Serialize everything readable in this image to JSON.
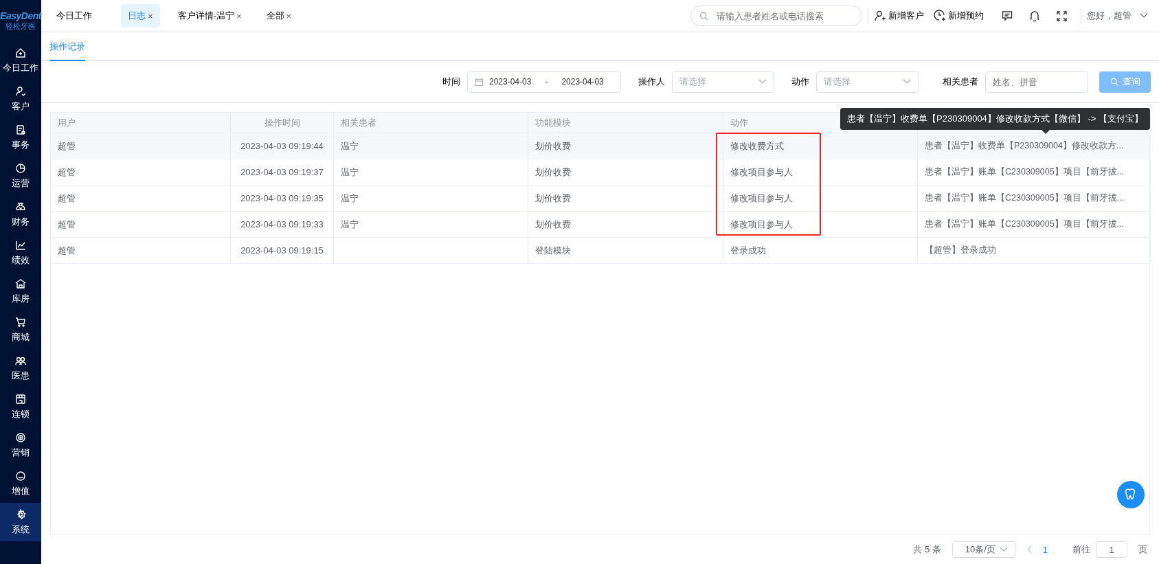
{
  "logo": {
    "brand": "EasyDent",
    "subtitle": "轻松牙医"
  },
  "sidebar": {
    "items": [
      {
        "label": "今日工作",
        "selected": false
      },
      {
        "label": "客户",
        "selected": false
      },
      {
        "label": "事务",
        "selected": false
      },
      {
        "label": "运营",
        "selected": false
      },
      {
        "label": "财务",
        "selected": false
      },
      {
        "label": "绩效",
        "selected": false
      },
      {
        "label": "库房",
        "selected": false
      },
      {
        "label": "商城",
        "selected": false
      },
      {
        "label": "医患",
        "selected": false
      },
      {
        "label": "连锁",
        "selected": false
      },
      {
        "label": "营销",
        "selected": false
      },
      {
        "label": "增值",
        "selected": false
      },
      {
        "label": "系统",
        "selected": true
      }
    ]
  },
  "tabs": [
    {
      "label": "今日工作",
      "selected": false
    },
    {
      "label": "日志",
      "selected": true,
      "close": "×"
    },
    {
      "label": "客户详情-温宁",
      "selected": false,
      "close": "×"
    },
    {
      "label": "全部",
      "selected": false,
      "close": "×"
    }
  ],
  "search": {
    "placeholder": "请输入患者姓名或电话搜索"
  },
  "header_actions": [
    {
      "label": "新增客户"
    },
    {
      "label": "新增预约"
    }
  ],
  "user": {
    "greeting": "您好，超管"
  },
  "subtabs": [
    {
      "label": "操作记录",
      "selected": true
    }
  ],
  "filters": {
    "time": {
      "label": "时间",
      "start": "2023-04-03",
      "separator": "-",
      "end": "2023-04-03"
    },
    "operator": {
      "label": "操作人",
      "placeholder": "请选择"
    },
    "action": {
      "label": "动作",
      "placeholder": "请选择"
    },
    "patient": {
      "label": "相关患者",
      "placeholder": "姓名、拼音"
    },
    "query_button": "查询"
  },
  "table": {
    "columns": [
      "用户",
      "操作时间",
      "相关患者",
      "功能模块",
      "动作"
    ],
    "rows": [
      {
        "hovered": true,
        "boxed": true,
        "cells": [
          "超管",
          "2023-04-03 09:19:44",
          "温宁",
          "划价收费",
          "修改收费方式",
          "患者【温宁】收费单【P230309004】修改收款方..."
        ]
      },
      {
        "hovered": false,
        "boxed": true,
        "cells": [
          "超管",
          "2023-04-03 09:19:37",
          "温宁",
          "划价收费",
          "修改项目参与人",
          "患者【温宁】账单【C230309005】项目【前牙拔..."
        ]
      },
      {
        "hovered": false,
        "boxed": true,
        "cells": [
          "超管",
          "2023-04-03 09:19:35",
          "温宁",
          "划价收费",
          "修改项目参与人",
          "患者【温宁】账单【C230309005】项目【前牙拔..."
        ]
      },
      {
        "hovered": false,
        "boxed": true,
        "cells": [
          "超管",
          "2023-04-03 09:19:33",
          "温宁",
          "划价收费",
          "修改项目参与人",
          "患者【温宁】账单【C230309005】项目【前牙拔..."
        ]
      },
      {
        "hovered": false,
        "boxed": false,
        "cells": [
          "超管",
          "2023-04-03 09:19:15",
          "",
          "登陆模块",
          "登录成功",
          "【超管】登录成功"
        ]
      }
    ]
  },
  "tooltip": "患者【温宁】收费单【P230309004】修改收款方式【微信】 -> 【支付宝】",
  "pagination": {
    "total": "共 5 条",
    "page_size": "10条/页",
    "pages": [
      {
        "label": "1",
        "selected": true
      }
    ],
    "goto_label": "前往",
    "goto_value": "1",
    "page_suffix": "页"
  }
}
